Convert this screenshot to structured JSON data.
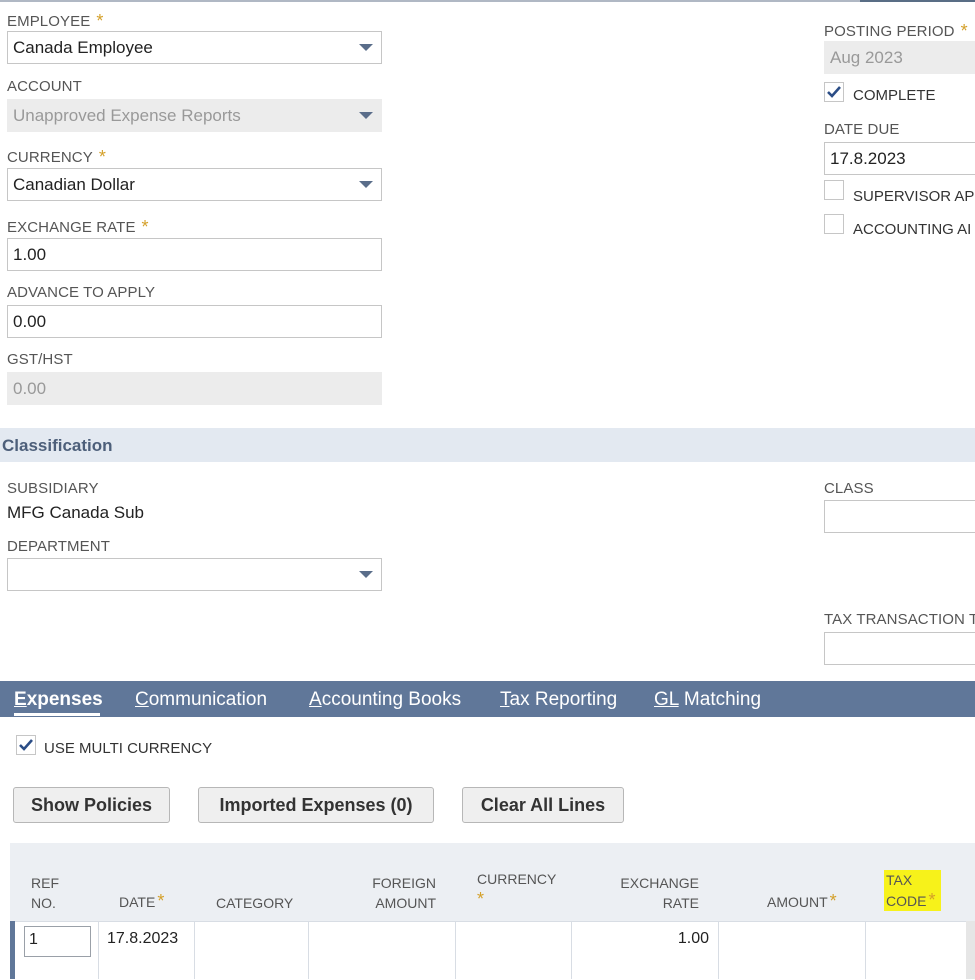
{
  "main": {
    "employee": {
      "label": "EMPLOYEE",
      "value": "Canada Employee"
    },
    "account": {
      "label": "ACCOUNT",
      "value": "Unapproved Expense Reports"
    },
    "currency": {
      "label": "CURRENCY",
      "value": "Canadian Dollar"
    },
    "exchange_rate": {
      "label": "EXCHANGE RATE",
      "value": "1.00"
    },
    "advance": {
      "label": "ADVANCE TO APPLY",
      "value": "0.00"
    },
    "gst": {
      "label": "GST/HST",
      "value": "0.00"
    },
    "required_mark": "*"
  },
  "right": {
    "posting_period": {
      "label": "POSTING PERIOD",
      "value": "Aug 2023"
    },
    "complete": {
      "label": "COMPLETE",
      "checked": true
    },
    "date_due": {
      "label": "DATE DUE",
      "value": "17.8.2023"
    },
    "supervisor": {
      "label": "SUPERVISOR API",
      "checked": false
    },
    "accounting": {
      "label": "ACCOUNTING AI",
      "checked": false
    }
  },
  "classification": {
    "title": "Classification",
    "subsidiary": {
      "label": "SUBSIDIARY",
      "value": "MFG Canada Sub"
    },
    "department": {
      "label": "DEPARTMENT",
      "value": ""
    },
    "class": {
      "label": "CLASS",
      "value": ""
    },
    "tax_transaction": {
      "label": "TAX TRANSACTION T",
      "value": ""
    }
  },
  "tabs": [
    {
      "first": "E",
      "rest": "xpenses"
    },
    {
      "first": "C",
      "rest": "ommunication"
    },
    {
      "first": "A",
      "rest": "ccounting Books"
    },
    {
      "first": "T",
      "rest": "ax Reporting"
    },
    {
      "first": "GL",
      "rest": " Matching"
    }
  ],
  "multi_currency": {
    "label": "USE MULTI CURRENCY",
    "checked": true
  },
  "buttons": {
    "show_policies": "Show Policies",
    "imported": "Imported Expenses (0)",
    "clear": "Clear All Lines"
  },
  "grid": {
    "headers": {
      "ref_1": "REF",
      "ref_2": "NO.",
      "date": "DATE",
      "category": "CATEGORY",
      "foreign_1": "FOREIGN",
      "foreign_2": "AMOUNT",
      "currency": "CURRENCY",
      "exrate_1": "EXCHANGE",
      "exrate_2": "RATE",
      "amount": "AMOUNT",
      "tax_1": "TAX",
      "tax_2": "CODE"
    },
    "row": {
      "ref": "1",
      "date": "17.8.2023",
      "exchange_rate": "1.00"
    }
  },
  "colors": {
    "tabbar": "#607799",
    "required": "#d4a02a",
    "highlight": "#f7f21a"
  }
}
